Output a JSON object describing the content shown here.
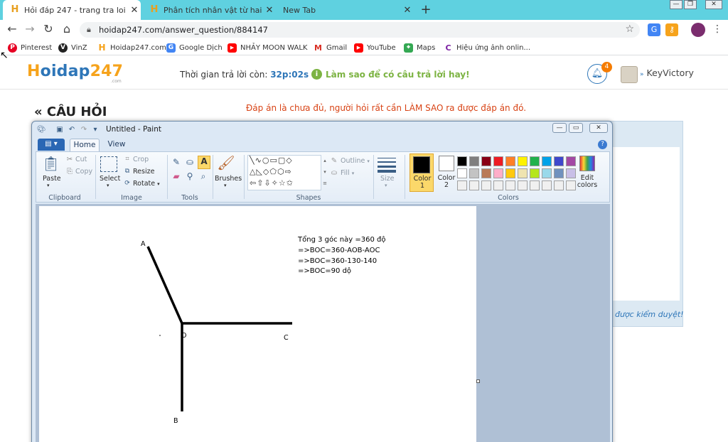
{
  "browser": {
    "tabs": [
      {
        "title": "Hỏi đáp 247 - trang tra loi",
        "active": true,
        "icon": "hoidap-favicon"
      },
      {
        "title": "Phân tích nhân vật từ hai trong c",
        "active": false,
        "icon": "hoidap-favicon"
      },
      {
        "title": "New Tab",
        "active": false,
        "icon": ""
      }
    ],
    "new_tab_label": "+",
    "url": "hoidap247.com/answer_question/884147",
    "bookmarks": [
      {
        "label": "Pinterest",
        "icon": "pinterest-icon",
        "color": "#e60023",
        "glyph": "P"
      },
      {
        "label": "VinZ",
        "icon": "vinz-icon",
        "color": "#222222",
        "glyph": "V"
      },
      {
        "label": "Hoidap247.com",
        "icon": "hoidap-favicon",
        "color": "#f6a31c",
        "glyph": "H"
      },
      {
        "label": "Google Dịch",
        "icon": "google-translate-icon",
        "color": "#4285f4",
        "glyph": "G"
      },
      {
        "label": "NHẢY MOON WALK",
        "icon": "youtube-icon",
        "color": "#ff0000",
        "glyph": "▶"
      },
      {
        "label": "Gmail",
        "icon": "gmail-icon",
        "color": "#d93025",
        "glyph": "M"
      },
      {
        "label": "YouTube",
        "icon": "youtube-icon",
        "color": "#ff0000",
        "glyph": "▶"
      },
      {
        "label": "Maps",
        "icon": "maps-icon",
        "color": "#34a853",
        "glyph": "⌖"
      },
      {
        "label": "Hiệu ứng ảnh onlin...",
        "icon": "photo-effect-icon",
        "color": "#7b1fa2",
        "glyph": "C"
      }
    ]
  },
  "site": {
    "logo_h": "H",
    "logo_text": "oidap",
    "logo_num": "247",
    "logo_sub": ".com",
    "timer_label": "Thời gian trả lời còn: ",
    "timer_value": "32p:02s",
    "tip": "Làm sao để có câu trả lời hay!",
    "notification_count": "4",
    "username": "KeyVictory",
    "question_heading": "« CÂU HỎI",
    "warning": "Đáp án là chưa đủ, người hỏi rất cần LÀM SAO ra được đáp án đó.",
    "review_note": "được kiểm duyệt!"
  },
  "paint": {
    "window_title": "Untitled - Paint",
    "tabs": [
      "Home",
      "View"
    ],
    "groups": {
      "clipboard": "Clipboard",
      "image": "Image",
      "tools": "Tools",
      "shapes": "Shapes",
      "colors": "Colors"
    },
    "buttons": {
      "paste": "Paste",
      "cut": "Cut",
      "copy": "Copy",
      "select": "Select",
      "crop": "Crop",
      "resize": "Resize",
      "rotate": "Rotate",
      "brushes": "Brushes",
      "outline": "Outline",
      "fill": "Fill",
      "size": "Size",
      "color1": "Color\n1",
      "color1_a": "Color",
      "color1_b": "1",
      "color2_a": "Color",
      "color2_b": "2",
      "edit_colors_a": "Edit",
      "edit_colors_b": "colors"
    },
    "palette": [
      "#000000",
      "#7f7f7f",
      "#880015",
      "#ed1c24",
      "#ff7f27",
      "#fff200",
      "#22b14c",
      "#00a2e8",
      "#3f48cc",
      "#a349a4",
      "#ffffff",
      "#c3c3c3",
      "#b97a57",
      "#ffaec9",
      "#ffc90e",
      "#efe4b0",
      "#b5e61d",
      "#99d9ea",
      "#7092be",
      "#c8bfe7",
      "#f0f0f0",
      "#f0f0f0",
      "#f0f0f0",
      "#f0f0f0",
      "#f0f0f0",
      "#f0f0f0",
      "#f0f0f0",
      "#f0f0f0",
      "#f0f0f0",
      "#f0f0f0"
    ],
    "canvas": {
      "point_labels": {
        "A": "A",
        "O": "O",
        "C": "C",
        "B": "B"
      },
      "notes": [
        "Tổng 3 góc này =360 độ",
        "=>BOC=360-AOB-AOC",
        "=>BOC=360-130-140",
        "=>BOC=90 dộ"
      ]
    }
  }
}
